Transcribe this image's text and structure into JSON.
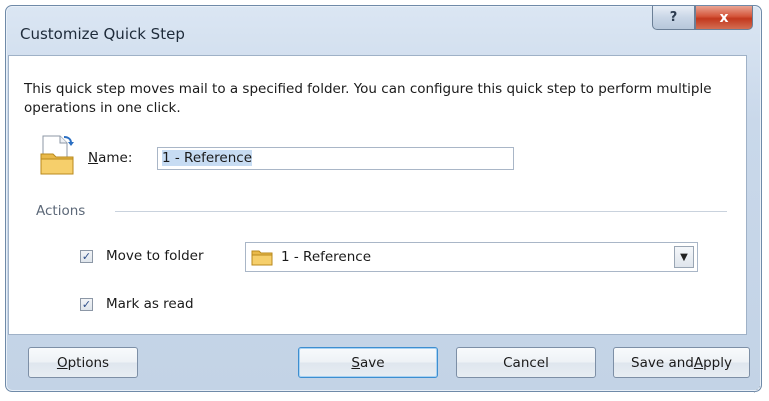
{
  "dialog": {
    "title": "Customize Quick Step",
    "help_glyph": "?",
    "close_glyph": "x"
  },
  "description": "This quick step moves mail to a specified folder.  You can configure this quick step to perform multiple operations in one click.",
  "name_field": {
    "label_mnemonic": "N",
    "label_rest": "ame:",
    "value": "1 - Reference"
  },
  "actions": {
    "section_label": "Actions",
    "move_to_folder": {
      "label": "Move to folder",
      "checked": true,
      "folder_value": "1 - Reference"
    },
    "mark_as_read": {
      "label": "Mark as read",
      "checked": true
    }
  },
  "buttons": {
    "options_mnemonic": "O",
    "options_rest": "ptions",
    "save_mnemonic": "S",
    "save_rest": "ave",
    "cancel": "Cancel",
    "apply_pre": "Save and ",
    "apply_mnemonic": "A",
    "apply_rest": "pply"
  },
  "icons": {
    "quick_step": "folder-move-icon",
    "folder": "folder-icon",
    "dropdown": "dropdown-arrow-icon",
    "checkmark": "✓"
  },
  "colors": {
    "frame": "#c3d3e6",
    "close": "#c2381e",
    "selection": "#c7dcf3",
    "default_button_border": "#3d8ed0"
  }
}
